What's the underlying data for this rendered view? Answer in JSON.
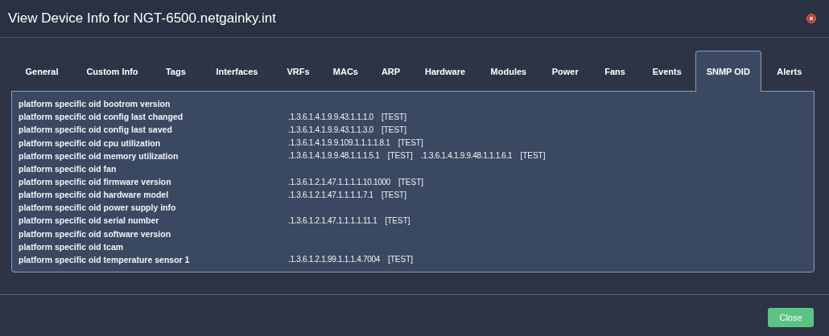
{
  "window": {
    "title": "View Device Info for NGT-6500.netgainky.int"
  },
  "tabs": [
    {
      "label": "General",
      "selected": false
    },
    {
      "label": "Custom Info",
      "selected": false
    },
    {
      "label": "Tags",
      "selected": false
    },
    {
      "label": "Interfaces",
      "selected": false
    },
    {
      "label": "VRFs",
      "selected": false
    },
    {
      "label": "MACs",
      "selected": false
    },
    {
      "label": "ARP",
      "selected": false
    },
    {
      "label": "Hardware",
      "selected": false
    },
    {
      "label": "Modules",
      "selected": false
    },
    {
      "label": "Power",
      "selected": false
    },
    {
      "label": "Fans",
      "selected": false
    },
    {
      "label": "Events",
      "selected": false
    },
    {
      "label": "SNMP OID",
      "selected": true
    },
    {
      "label": "Alerts",
      "selected": false
    }
  ],
  "oid_rows": [
    {
      "name": "platform specific oid bootrom version",
      "oids": []
    },
    {
      "name": "platform specific oid config last changed",
      "oids": [
        {
          "oid": ".1.3.6.1.4.1.9.9.43.1.1.1.0",
          "test": "[TEST]"
        }
      ]
    },
    {
      "name": "platform specific oid config last saved",
      "oids": [
        {
          "oid": ".1.3.6.1.4.1.9.9.43.1.1.3.0",
          "test": "[TEST]"
        }
      ]
    },
    {
      "name": "platform specific oid cpu utilization",
      "oids": [
        {
          "oid": ".1.3.6.1.4.1.9.9.109.1.1.1.1.8.1",
          "test": "[TEST]"
        }
      ]
    },
    {
      "name": "platform specific oid memory utilization",
      "oids": [
        {
          "oid": ".1.3.6.1.4.1.9.9.48.1.1.1.5.1",
          "test": "[TEST]"
        },
        {
          "oid": ".1.3.6.1.4.1.9.9.48.1.1.1.6.1",
          "test": "[TEST]"
        }
      ]
    },
    {
      "name": "platform specific oid fan",
      "oids": []
    },
    {
      "name": "platform specific oid firmware version",
      "oids": [
        {
          "oid": ".1.3.6.1.2.1.47.1.1.1.1.10.1000",
          "test": "[TEST]"
        }
      ]
    },
    {
      "name": "platform specific oid hardware model",
      "oids": [
        {
          "oid": ".1.3.6.1.2.1.47.1.1.1.1.7.1",
          "test": "[TEST]"
        }
      ]
    },
    {
      "name": "platform specific oid power supply info",
      "oids": []
    },
    {
      "name": "platform specific oid serial number",
      "oids": [
        {
          "oid": ".1.3.6.1.2.1.47.1.1.1.1.11.1",
          "test": "[TEST]"
        }
      ]
    },
    {
      "name": "platform specific oid software version",
      "oids": []
    },
    {
      "name": "platform specific oid tcam",
      "oids": []
    },
    {
      "name": "platform specific oid temperature sensor 1",
      "oids": [
        {
          "oid": ".1.3.6.1.2.1.99.1.1.1.4.7004",
          "test": "[TEST]"
        }
      ]
    }
  ],
  "buttons": [
    "Close"
  ]
}
